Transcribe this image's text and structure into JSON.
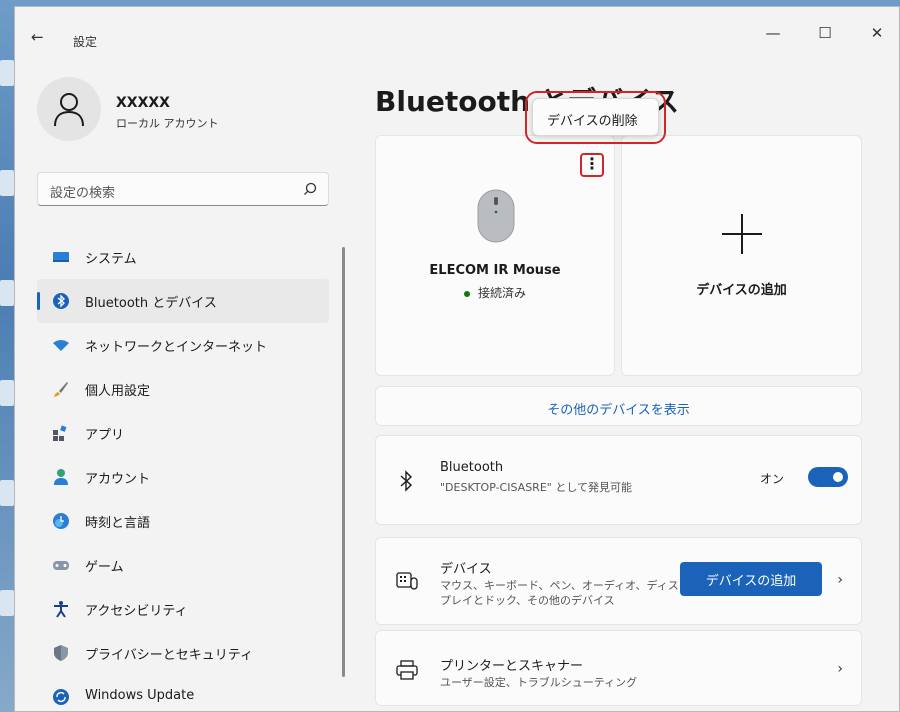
{
  "window": {
    "title": "設定",
    "back_glyph": "←",
    "minimize_glyph": "—",
    "maximize_glyph": "☐",
    "close_glyph": "✕"
  },
  "user": {
    "name": "XXXXX",
    "account_type": "ローカル アカウント"
  },
  "search": {
    "placeholder": "設定の検索"
  },
  "sidebar": {
    "items": [
      {
        "label": "システム",
        "icon": "monitor-icon"
      },
      {
        "label": "Bluetooth とデバイス",
        "icon": "bluetooth-icon",
        "selected": true
      },
      {
        "label": "ネットワークとインターネット",
        "icon": "wifi-icon"
      },
      {
        "label": "個人用設定",
        "icon": "brush-icon"
      },
      {
        "label": "アプリ",
        "icon": "apps-icon"
      },
      {
        "label": "アカウント",
        "icon": "person-icon"
      },
      {
        "label": "時刻と言語",
        "icon": "globe-clock-icon"
      },
      {
        "label": "ゲーム",
        "icon": "gamepad-icon"
      },
      {
        "label": "アクセシビリティ",
        "icon": "accessibility-icon"
      },
      {
        "label": "プライバシーとセキュリティ",
        "icon": "shield-icon"
      },
      {
        "label": "Windows Update",
        "icon": "update-icon"
      }
    ]
  },
  "main": {
    "title": "Bluetooth とデバイス",
    "device_card": {
      "name": "ELECOM IR Mouse",
      "status": "接続済み",
      "more_glyph": "⋮"
    },
    "add_card": {
      "label": "デバイスの追加"
    },
    "more_devices_link": "その他のデバイスを表示",
    "bluetooth_row": {
      "title": "Bluetooth",
      "subtitle": "\"DESKTOP-CISASRE\" として発見可能",
      "toggle_label": "オン",
      "toggle_on": true
    },
    "devices_row": {
      "title": "デバイス",
      "subtitle_line1": "マウス、キーボード、ペン、オーディオ、ディス",
      "subtitle_line2": "プレイとドック、その他のデバイス",
      "button_label": "デバイスの追加",
      "chevron": "›"
    },
    "printers_row": {
      "title": "プリンターとスキャナー",
      "subtitle": "ユーザー設定、トラブルシューティング",
      "chevron": "›"
    }
  },
  "context_menu": {
    "items": [
      {
        "label": "デバイスの削除"
      }
    ]
  },
  "colors": {
    "accent": "#1a63b8",
    "highlight_outline": "#d4242b",
    "connected_dot": "#0f7b0f"
  }
}
